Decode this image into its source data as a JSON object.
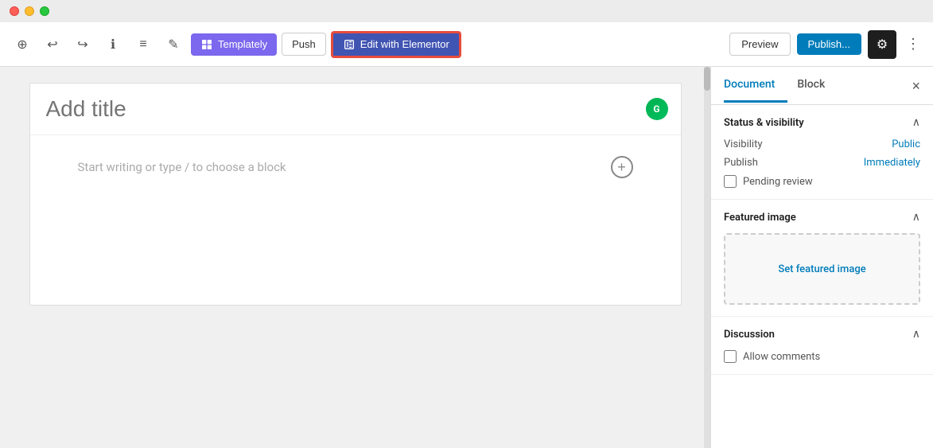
{
  "titlebar": {
    "traffic_lights": [
      "red",
      "yellow",
      "green"
    ]
  },
  "toolbar": {
    "add_label": "+",
    "undo_label": "↩",
    "redo_label": "↪",
    "info_label": "ℹ",
    "list_label": "≡",
    "edit_label": "✏",
    "templately_label": "Templately",
    "push_label": "Push",
    "elementor_label": "Edit with Elementor",
    "preview_label": "Preview",
    "publish_label": "Publish...",
    "settings_label": "⚙",
    "more_label": "⋮"
  },
  "editor": {
    "title_placeholder": "Add title",
    "body_placeholder": "Start writing or type / to choose a block",
    "grammarly_label": "G"
  },
  "sidebar": {
    "tab_document": "Document",
    "tab_block": "Block",
    "close_label": "×",
    "status_section": {
      "title": "Status & visibility",
      "visibility_label": "Visibility",
      "visibility_value": "Public",
      "publish_label": "Publish",
      "publish_value": "Immediately",
      "pending_review_label": "Pending review"
    },
    "featured_image_section": {
      "title": "Featured image",
      "set_image_label": "Set featured image"
    },
    "discussion_section": {
      "title": "Discussion",
      "allow_comments_label": "Allow comments"
    }
  }
}
